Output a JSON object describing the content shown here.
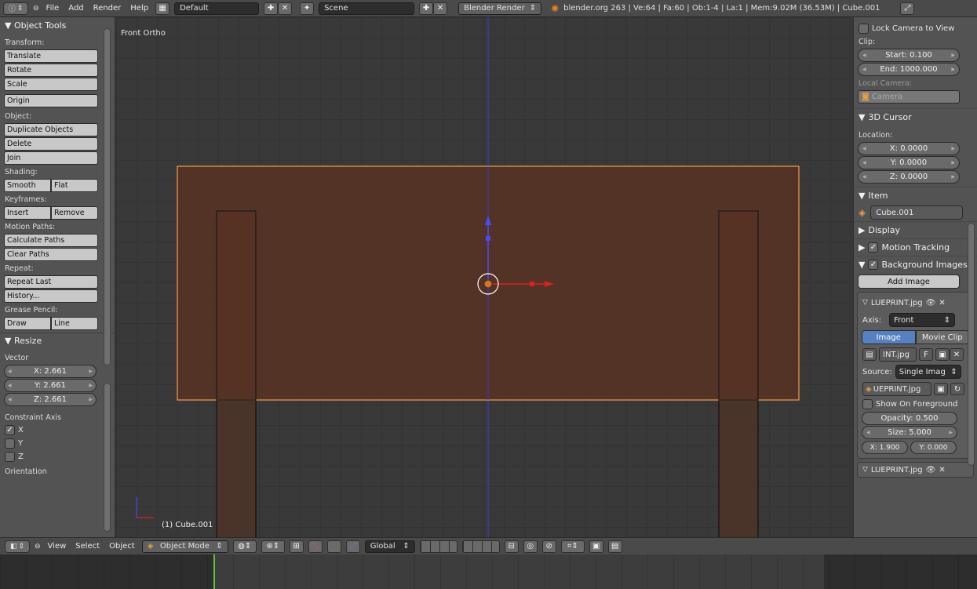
{
  "topbar": {
    "menus": [
      "File",
      "Add",
      "Render",
      "Help"
    ],
    "layout": "Default",
    "scene": "Scene",
    "engine": "Blender Render",
    "stats": "blender.org 263 | Ve:64 | Fa:60 | Ob:1-4 | La:1 | Mem:9.02M (36.53M) | Cube.001"
  },
  "tools": {
    "title": "Object Tools",
    "transform_label": "Transform:",
    "translate": "Translate",
    "rotate": "Rotate",
    "scale": "Scale",
    "origin": "Origin",
    "object_label": "Object:",
    "duplicate": "Duplicate Objects",
    "delete": "Delete",
    "join": "Join",
    "shading_label": "Shading:",
    "smooth": "Smooth",
    "flat": "Flat",
    "keyframes_label": "Keyframes:",
    "insert": "Insert",
    "remove": "Remove",
    "motion_label": "Motion Paths:",
    "calc_paths": "Calculate Paths",
    "clear_paths": "Clear Paths",
    "repeat_label": "Repeat:",
    "repeat_last": "Repeat Last",
    "history": "History...",
    "grease_label": "Grease Pencil:",
    "draw": "Draw",
    "line": "Line"
  },
  "resize": {
    "title": "Resize",
    "vector_label": "Vector",
    "x": "X: 2.661",
    "y": "Y: 2.661",
    "z": "Z: 2.661",
    "constraint_label": "Constraint Axis",
    "cx": "X",
    "cy": "Y",
    "cz": "Z",
    "orientation_label": "Orientation"
  },
  "viewport": {
    "view_label": "Front Ortho",
    "object_label": "(1) Cube.001"
  },
  "props": {
    "lock_camera": "Lock Camera to View",
    "clip_label": "Clip:",
    "clip_start": "Start: 0.100",
    "clip_end": "End: 1000.000",
    "local_camera_label": "Local Camera:",
    "camera": "Camera",
    "cursor_title": "3D Cursor",
    "location_label": "Location:",
    "cx": "X: 0.0000",
    "cy": "Y: 0.0000",
    "cz": "Z: 0.0000",
    "item_title": "Item",
    "item_name": "Cube.001",
    "display_title": "Display",
    "motion_tracking_title": "Motion Tracking",
    "bg_images_title": "Background Images",
    "add_image": "Add Image",
    "bg_name": "LUEPRINT.jpg",
    "axis_label": "Axis:",
    "axis_value": "Front",
    "image_tab": "Image",
    "movie_tab": "Movie Clip",
    "img_file": "INT.jpg",
    "img_flag": "F",
    "source_label": "Source:",
    "source_value": "Single Imag",
    "source_file": "UEPRINT.jpg",
    "show_fg": "Show On Foreground",
    "opacity": "Opacity: 0.500",
    "size": "Size: 5.000",
    "offx": "X: 1.900",
    "offy": "Y: 0.000",
    "bg_name_2": "LUEPRINT.jpg"
  },
  "bottombar": {
    "view": "View",
    "select": "Select",
    "object": "Object",
    "mode": "Object Mode",
    "orientation": "Global"
  }
}
